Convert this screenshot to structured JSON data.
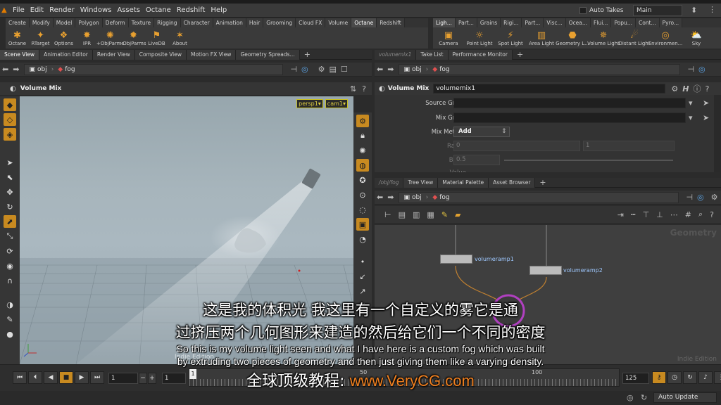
{
  "menu": [
    "File",
    "Edit",
    "Render",
    "Windows",
    "Assets",
    "Octane",
    "Redshift",
    "Help"
  ],
  "auto_takes": "Auto Takes",
  "desktop": "Main",
  "shelf_left_tabs": [
    "Create",
    "Modify",
    "Model",
    "Polygon",
    "Deform",
    "Texture",
    "Rigging",
    "Character",
    "Animation",
    "Hair",
    "Grooming",
    "Cloud FX",
    "Volume",
    "Octane",
    "Redshift"
  ],
  "shelf_left_active": 13,
  "shelf_left_tools": [
    {
      "label": "Octane",
      "icon": "octane-icon"
    },
    {
      "label": "RTarget",
      "icon": "rtarget-icon"
    },
    {
      "label": "Options",
      "icon": "options-icon"
    },
    {
      "label": "IPR",
      "icon": "ipr-icon"
    },
    {
      "label": "+ObjParms",
      "icon": "add-objparms-icon"
    },
    {
      "label": "-ObjParms",
      "icon": "remove-objparms-icon"
    },
    {
      "label": "LiveDB",
      "icon": "livedb-icon"
    },
    {
      "label": "About",
      "icon": "about-icon"
    }
  ],
  "shelf_right_tabs": [
    "Ligh...",
    "Part...",
    "Grains",
    "Rigi...",
    "Part...",
    "Visc...",
    "Ocea...",
    "Flui...",
    "Popu...",
    "Cont...",
    "Pyro..."
  ],
  "shelf_right_tools": [
    {
      "label": "Camera",
      "icon": "camera-icon"
    },
    {
      "label": "Point Light",
      "icon": "point-light-icon"
    },
    {
      "label": "Spot Light",
      "icon": "spot-light-icon"
    },
    {
      "label": "Area Light",
      "icon": "area-light-icon"
    },
    {
      "label": "Geometry L...",
      "icon": "geometry-light-icon"
    },
    {
      "label": "Volume Light",
      "icon": "volume-light-icon"
    },
    {
      "label": "Distant Light",
      "icon": "distant-light-icon"
    },
    {
      "label": "Environmen...",
      "icon": "environment-light-icon"
    },
    {
      "label": "Sky",
      "icon": "sky-icon"
    }
  ],
  "left_pane_tabs": [
    "Scene View",
    "Animation Editor",
    "Render View",
    "Composite View",
    "Motion FX View",
    "Geometry Spreads..."
  ],
  "param_pane_tabs": [
    "volumemix1",
    "Take List",
    "Performance Monitor"
  ],
  "path": {
    "root": "obj",
    "node": "fog"
  },
  "viewport": {
    "title": "Volume Mix",
    "persp": "persp1",
    "cam": "cam1"
  },
  "param": {
    "node_type": "Volume Mix",
    "node_name": "volumemix1",
    "rows": [
      {
        "label": "Source Group",
        "value": ""
      },
      {
        "label": "Mix Group",
        "value": ""
      },
      {
        "label": "Mix Method",
        "value": "Add"
      },
      {
        "label": "Range",
        "value": "0",
        "value2": "1"
      },
      {
        "label": "Blend",
        "value": "0.5"
      },
      {
        "label": "Value",
        "value": ""
      }
    ]
  },
  "network_pane_tabs": [
    "/obj/fog",
    "Tree View",
    "Material Palette",
    "Asset Browser"
  ],
  "network": {
    "context_label": "Geometry",
    "edition_label": "Indie Edition",
    "nodes": [
      "volumeramp1",
      "volumeramp2"
    ]
  },
  "viewport_edition_label": "Indie Edition",
  "playbar": {
    "current_frame": "1",
    "start_frame": "1",
    "end_frame": "125",
    "ruler_start": "1",
    "ticks": [
      "50",
      "100"
    ]
  },
  "status": {
    "auto_update": "Auto Update"
  },
  "subtitles": {
    "cn_line1": "这是我的体积光 我这里有一个自定义的雾它是通",
    "cn_line2": "过挤压两个几何图形来建造的然后给它们一个不同的密度",
    "en_line1": "So this is my volume light seen and what I have here is a custom fog which was built",
    "en_line2": "by extruding two pieces of geometry and then just giving them like a varying density."
  },
  "watermark": {
    "cn": "全球顶级教程:",
    "url": "www.VeryCG.com"
  },
  "colors": {
    "accent": "#c88a20",
    "watermark_url": "#f08020"
  }
}
